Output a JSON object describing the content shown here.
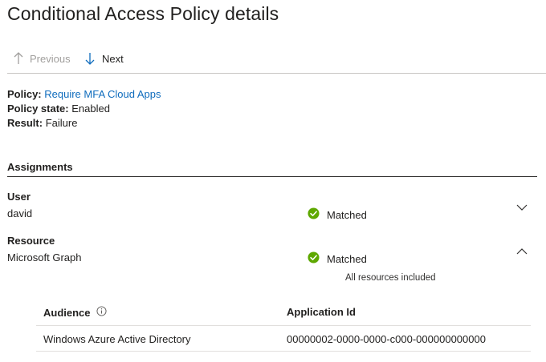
{
  "page": {
    "title": "Conditional Access Policy details"
  },
  "toolbar": {
    "previous_label": "Previous",
    "next_label": "Next",
    "previous_icon": "arrow-up-icon",
    "next_icon": "arrow-down-icon"
  },
  "policy": {
    "policy_label": "Policy:",
    "policy_value": "Require MFA Cloud Apps",
    "state_label": "Policy state:",
    "state_value": "Enabled",
    "result_label": "Result:",
    "result_value": "Failure"
  },
  "assignments": {
    "heading": "Assignments",
    "user": {
      "label": "User",
      "value": "david",
      "status": "Matched",
      "expanded": false
    },
    "resource": {
      "label": "Resource",
      "value": "Microsoft Graph",
      "status": "Matched",
      "expanded": true,
      "note": "All resources included"
    }
  },
  "resource_table": {
    "columns": [
      "Audience",
      "Application Id"
    ],
    "rows": [
      [
        "Windows Azure Active Directory",
        "00000002-0000-0000-c000-000000000000"
      ]
    ]
  },
  "colors": {
    "link": "#0f6cbd",
    "success": "#5ea800",
    "disabled": "#a19f9d",
    "accent_arrow": "#0f6cbd"
  }
}
